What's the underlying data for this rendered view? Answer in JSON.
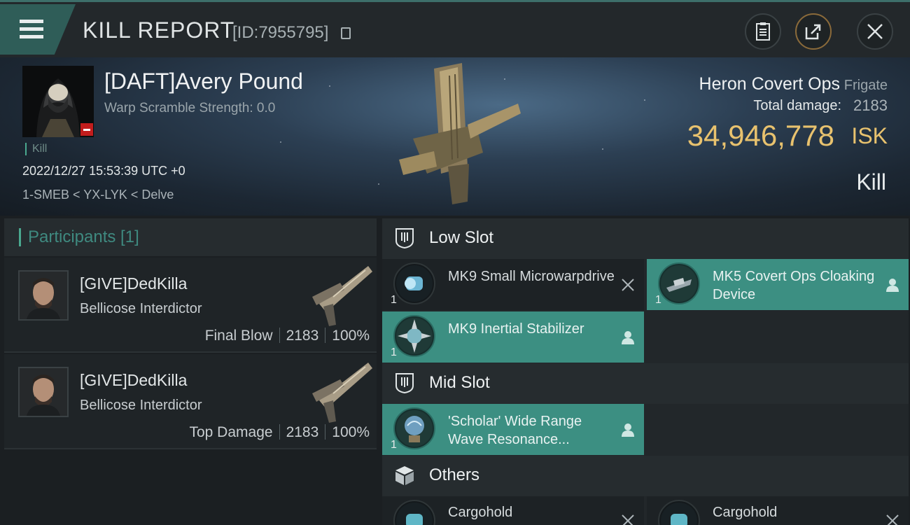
{
  "header": {
    "title": "KILL REPORT",
    "report_id": "[ID:7955795]"
  },
  "victim": {
    "name": "[DAFT]Avery Pound",
    "warp_scramble": "Warp Scramble Strength: 0.0",
    "kill_tag": "Kill",
    "datetime": "2022/12/27 15:53:39 UTC +0",
    "location": "1-SMEB < YX-LYK < Delve",
    "ship_name": "Heron Covert Ops",
    "ship_class": "Frigate",
    "damage_label": "Total damage:",
    "damage_value": "2183",
    "isk_value": "34,946,778",
    "isk_unit": "ISK",
    "result": "Kill"
  },
  "participants": {
    "header": "Participants [1]",
    "items": [
      {
        "name": "[GIVE]DedKilla",
        "ship": "Bellicose Interdictor",
        "role": "Final Blow",
        "damage": "2183",
        "percent": "100%"
      },
      {
        "name": "[GIVE]DedKilla",
        "ship": "Bellicose Interdictor",
        "role": "Top Damage",
        "damage": "2183",
        "percent": "100%"
      }
    ]
  },
  "slots": {
    "low": {
      "label": "Low Slot",
      "items": [
        {
          "name": "MK9 Small Microwarpdrive",
          "qty": "1",
          "status": "destroyed"
        },
        {
          "name": "MK5 Covert Ops Cloaking Device",
          "qty": "1",
          "status": "dropped"
        },
        {
          "name": "MK9 Inertial Stabilizer",
          "qty": "1",
          "status": "dropped"
        }
      ]
    },
    "mid": {
      "label": "Mid Slot",
      "items": [
        {
          "name": "'Scholar' Wide Range Wave Resonance...",
          "qty": "1",
          "status": "dropped"
        }
      ]
    },
    "others": {
      "label": "Others",
      "items": [
        {
          "name": "Cargohold",
          "status": "destroyed"
        },
        {
          "name": "Cargohold",
          "status": "destroyed"
        }
      ]
    }
  },
  "colors": {
    "accent_teal": "#3c8f82",
    "isk_gold": "#e8c26e",
    "badge_red": "#c21d1d"
  }
}
